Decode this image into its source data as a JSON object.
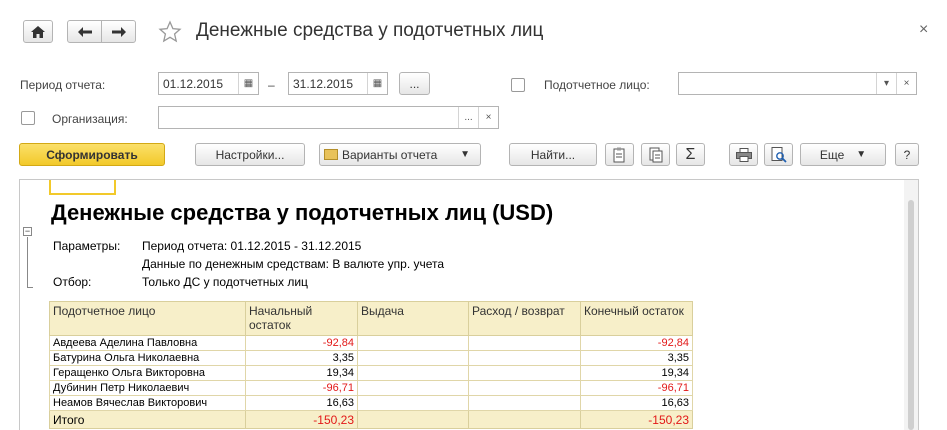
{
  "window": {
    "title": "Денежные средства у подотчетных лиц",
    "close_glyph": "×"
  },
  "filters": {
    "period_label": "Период отчета:",
    "period_from": "01.12.2015",
    "period_dash": "–",
    "period_to": "31.12.2015",
    "period_more": "...",
    "person_label": "Подотчетное лицо:",
    "person_value": "",
    "org_label": "Организация:",
    "org_value": ""
  },
  "toolbar": {
    "generate": "Сформировать",
    "settings": "Настройки...",
    "variants": "Варианты отчета",
    "find": "Найти...",
    "sum_glyph": "Σ",
    "more": "Еще",
    "help": "?"
  },
  "colors": {
    "generate_button": "#f5d33e",
    "header_fill": "#f7efc9",
    "negative": "#e21818"
  },
  "report": {
    "title": "Денежные средства у подотчетных лиц (USD)",
    "params_label": "Параметры:",
    "params_line1": "Период отчета: 01.12.2015 - 31.12.2015",
    "params_line2": "Данные по денежным средствам: В валюте упр. учета",
    "filter_label": "Отбор:",
    "filter_value": "Только ДС у подотчетных лиц",
    "columns": [
      "Подотчетное лицо",
      "Начальный остаток",
      "Выдача",
      "Расход / возврат",
      "Конечный остаток"
    ],
    "rows": [
      {
        "name": "Авдеева Аделина Павловна",
        "start": "-92,84",
        "issue": "",
        "expense": "",
        "end": "-92,84",
        "neg": true
      },
      {
        "name": "Батурина Ольга Николаевна",
        "start": "3,35",
        "issue": "",
        "expense": "",
        "end": "3,35",
        "neg": false
      },
      {
        "name": "Геращенко Ольга Викторовна",
        "start": "19,34",
        "issue": "",
        "expense": "",
        "end": "19,34",
        "neg": false
      },
      {
        "name": "Дубинин Петр Николаевич",
        "start": "-96,71",
        "issue": "",
        "expense": "",
        "end": "-96,71",
        "neg": true
      },
      {
        "name": "Неамов Вячеслав Викторович",
        "start": "16,63",
        "issue": "",
        "expense": "",
        "end": "16,63",
        "neg": false
      }
    ],
    "total": {
      "label": "Итого",
      "start": "-150,23",
      "issue": "",
      "expense": "",
      "end": "-150,23"
    }
  }
}
